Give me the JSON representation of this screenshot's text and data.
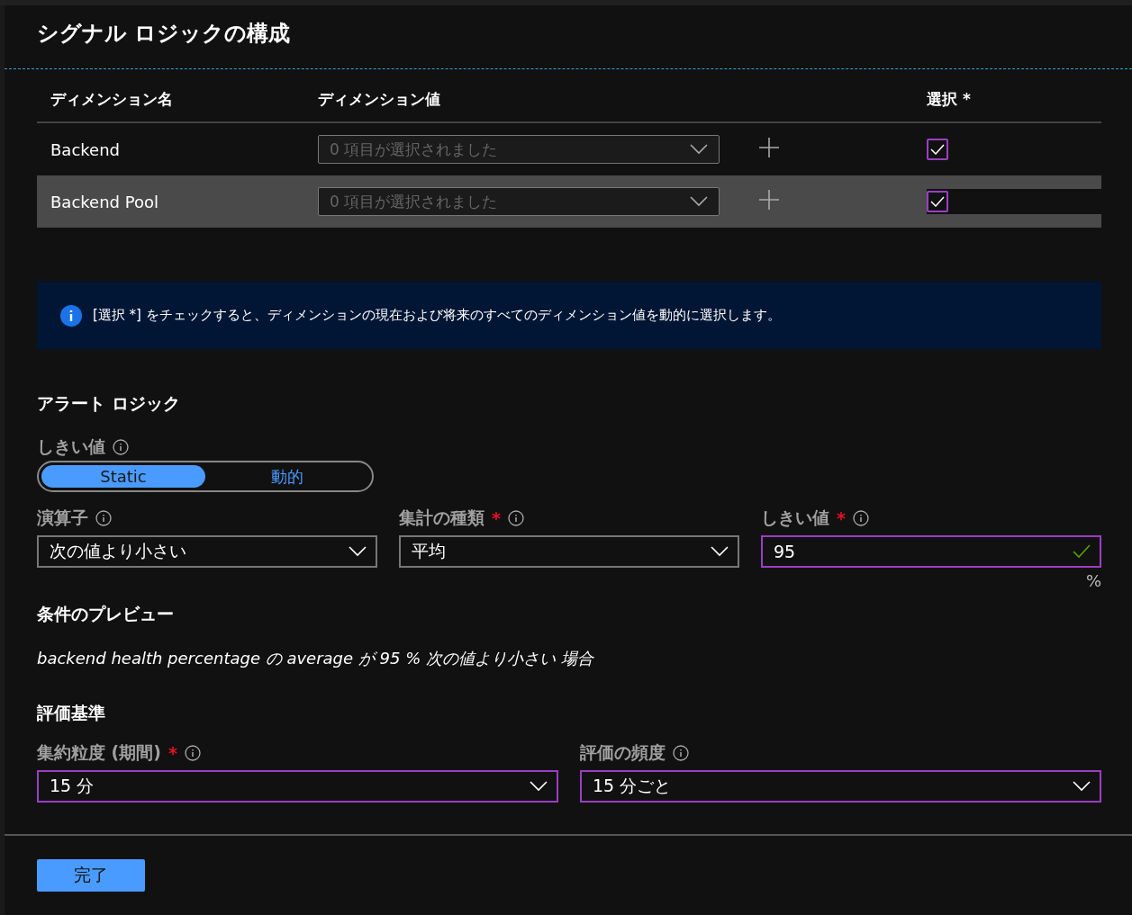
{
  "title": "シグナル ロジックの構成",
  "dimensions": {
    "columns": [
      "ディメンション名",
      "ディメンション値",
      "選択 *"
    ],
    "rows": [
      {
        "name": "Backend",
        "placeholder": "0 項目が選択されました",
        "checked": true,
        "selected": false
      },
      {
        "name": "Backend Pool",
        "placeholder": "0 項目が選択されました",
        "checked": true,
        "selected": true
      }
    ]
  },
  "info": "[選択 *] をチェックすると、ディメンションの現在および将来のすべてのディメンション値を動的に選択します。",
  "alert_logic": {
    "heading": "アラート ロジック",
    "threshold_label": "しきい値",
    "threshold_options": [
      {
        "label": "Static",
        "selected": true
      },
      {
        "label": "動的",
        "selected": false
      }
    ],
    "fields": [
      {
        "kind": "dropdown",
        "label": "演算子",
        "value": "次の値より小さい",
        "highlighted": false
      },
      {
        "kind": "dropdown",
        "label": "集計の種類",
        "required_mark": "*",
        "value": "平均",
        "highlighted": false
      },
      {
        "kind": "input",
        "label": "しきい値",
        "required_mark": "*",
        "value": "95",
        "highlighted": true,
        "valid": true,
        "unit": "%"
      }
    ]
  },
  "preview": {
    "heading": "条件のプレビュー",
    "text": "backend health percentage の average が 95 % 次の値より小さい 場合"
  },
  "evaluation": {
    "heading": "評価基準",
    "fields": [
      {
        "kind": "dropdown",
        "label": "集約粒度 (期間)",
        "required_mark": "*",
        "value": "15 分",
        "highlighted": true
      },
      {
        "kind": "dropdown",
        "label": "評価の頻度",
        "value": "15 分ごと",
        "highlighted": true
      }
    ]
  },
  "done_button": "完了"
}
